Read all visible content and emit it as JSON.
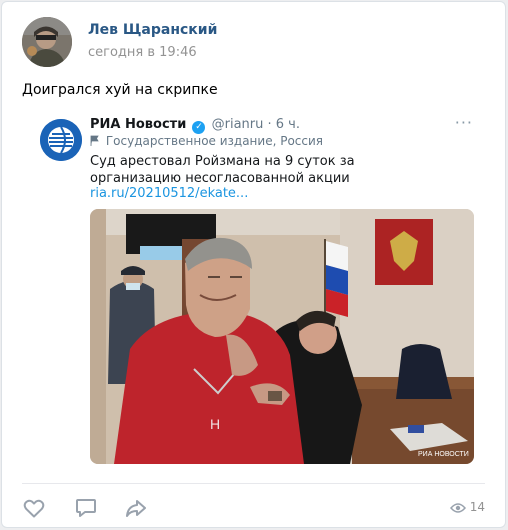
{
  "post": {
    "author": "Лев Щаранский",
    "time": "сегодня в 19:46",
    "text": "Доигрался хуй на скрипке",
    "views": "14"
  },
  "tweet": {
    "account_name": "РИА Новости",
    "handle_time": "@rianru · 6 ч.",
    "label": "Государственное издание, Россия",
    "text": "Суд арестовал Ройзмана на 9 суток за организацию несогласованной акции",
    "link": "ria.ru/20210512/ekate...",
    "more": "···",
    "photo_watermark": "РИА НОВОСТИ"
  },
  "icons": {
    "like": "heart-icon",
    "comment": "comment-icon",
    "share": "share-icon",
    "views": "eye-icon",
    "verified": "verified-check-icon"
  },
  "colors": {
    "author_link": "#2a5885",
    "twitter_link": "#1b95e0",
    "verified": "#1da1f2",
    "meta_gray": "#939393"
  }
}
